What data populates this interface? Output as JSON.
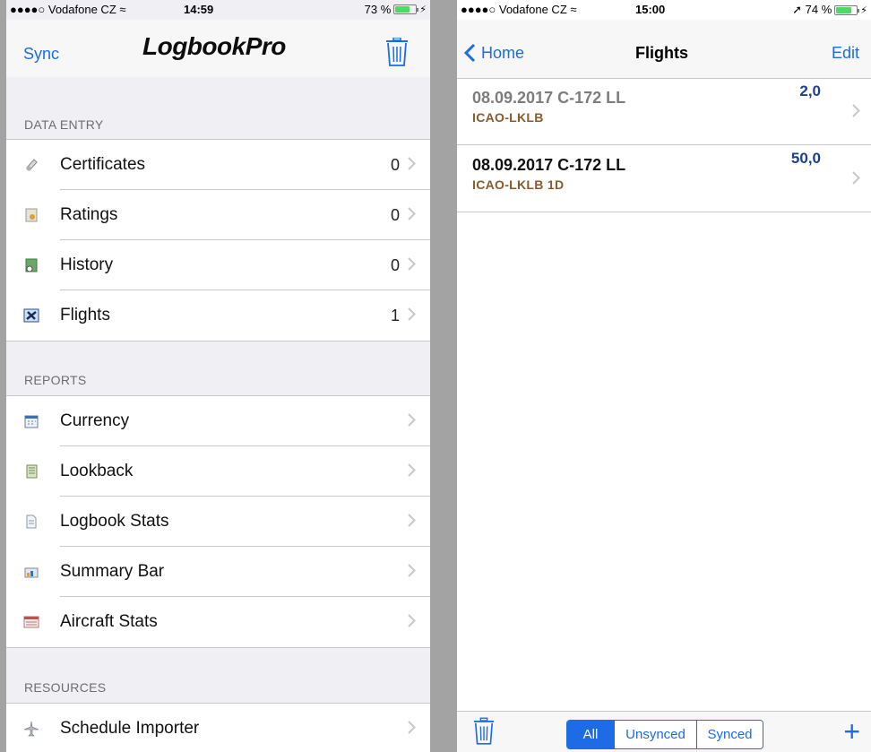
{
  "left": {
    "status": {
      "carrier": "●●●●○ Vodafone CZ ≈",
      "time": "14:59",
      "battery": "73 %",
      "battery_level": 0.73
    },
    "nav": {
      "sync_label": "Sync",
      "logo": "LogbookPro"
    },
    "sections": {
      "data_entry": {
        "header": "DATA ENTRY",
        "items": [
          {
            "label": "Certificates",
            "count": "0",
            "icon": "certificate-icon"
          },
          {
            "label": "Ratings",
            "count": "0",
            "icon": "ratings-icon"
          },
          {
            "label": "History",
            "count": "0",
            "icon": "history-icon"
          },
          {
            "label": "Flights",
            "count": "1",
            "icon": "flights-icon"
          }
        ]
      },
      "reports": {
        "header": "REPORTS",
        "items": [
          {
            "label": "Currency",
            "icon": "calendar-icon"
          },
          {
            "label": "Lookback",
            "icon": "notebook-icon"
          },
          {
            "label": "Logbook Stats",
            "icon": "document-icon"
          },
          {
            "label": "Summary Bar",
            "icon": "summary-icon"
          },
          {
            "label": "Aircraft Stats",
            "icon": "aircraft-stats-icon"
          }
        ]
      },
      "resources": {
        "header": "RESOURCES",
        "items": [
          {
            "label": "Schedule Importer",
            "icon": "airplane-icon"
          }
        ]
      }
    }
  },
  "right": {
    "status": {
      "carrier": "●●●●○ Vodafone CZ ≈",
      "time": "15:00",
      "battery": "➚ 74 %",
      "battery_level": 0.74
    },
    "nav": {
      "back_label": "Home",
      "title": "Flights",
      "edit_label": "Edit"
    },
    "flights": [
      {
        "title": "08.09.2017 C-172 LL",
        "route": "ICAO-LKLB",
        "hours": "2,0",
        "synced": true
      },
      {
        "title": "08.09.2017 C-172 LL",
        "route": "ICAO-LKLB 1D",
        "hours": "50,0",
        "synced": false
      }
    ],
    "toolbar": {
      "segments": [
        "All",
        "Unsynced",
        "Synced"
      ],
      "selected": "All"
    }
  },
  "colors": {
    "accent": "#1e6be6",
    "route": "#8a5a2b",
    "hours": "#1c3f95"
  }
}
